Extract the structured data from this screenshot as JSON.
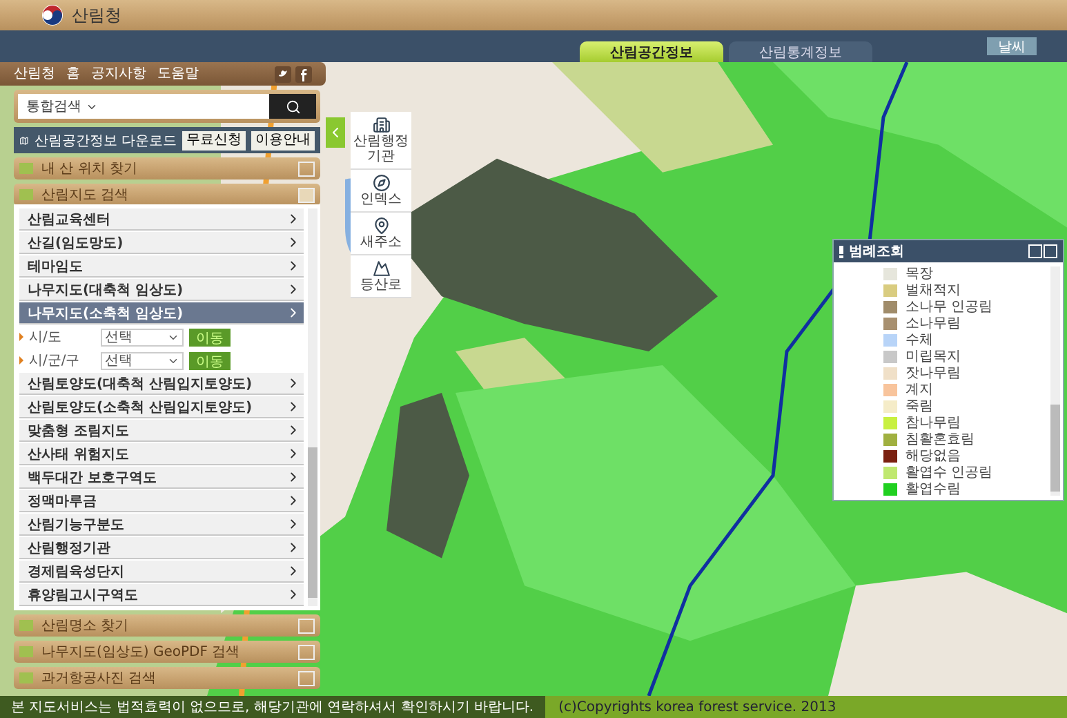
{
  "header": {
    "logo": "산림청"
  },
  "tabs": [
    {
      "label": "산림공간정보",
      "selected": true
    },
    {
      "label": "산림통계정보",
      "selected": false
    }
  ],
  "weather_button": "날씨",
  "nav": {
    "links": [
      "산림청",
      "홈",
      "공지사항",
      "도움말"
    ]
  },
  "search": {
    "scope": "통합검색"
  },
  "download": {
    "label": "산림공간정보 다운로드",
    "buttons": [
      "무료신청",
      "이용안내"
    ]
  },
  "sections": [
    {
      "label": "내 산 위치 찾기",
      "expanded": false
    },
    {
      "label": "산림지도 검색",
      "expanded": true,
      "items": [
        {
          "kind": "link",
          "label": "산림교육센터",
          "selected": false
        },
        {
          "kind": "link",
          "label": "산길(임도망도)",
          "selected": false
        },
        {
          "kind": "link",
          "label": "테마임도",
          "selected": false
        },
        {
          "kind": "link",
          "label": "나무지도(대축척 임상도)",
          "selected": false
        },
        {
          "kind": "link",
          "label": "나무지도(소축척 임상도)",
          "selected": true
        },
        {
          "kind": "select",
          "label": "시/도",
          "value": "선택",
          "button": "이동"
        },
        {
          "kind": "select",
          "label": "시/군/구",
          "value": "선택",
          "button": "이동"
        },
        {
          "kind": "link",
          "label": "산림토양도(대축척 산림입지토양도)",
          "selected": false
        },
        {
          "kind": "link",
          "label": "산림토양도(소축척 산림입지토양도)",
          "selected": false
        },
        {
          "kind": "link",
          "label": "맞춤형 조림지도",
          "selected": false
        },
        {
          "kind": "link",
          "label": "산사태 위험지도",
          "selected": false
        },
        {
          "kind": "link",
          "label": "백두대간 보호구역도",
          "selected": false
        },
        {
          "kind": "link",
          "label": "정맥마루금",
          "selected": false
        },
        {
          "kind": "link",
          "label": "산림기능구분도",
          "selected": false
        },
        {
          "kind": "link",
          "label": "산림행정기관",
          "selected": false
        },
        {
          "kind": "link",
          "label": "경제림육성단지",
          "selected": false
        },
        {
          "kind": "link",
          "label": "휴양림고시구역도",
          "selected": false
        }
      ]
    },
    {
      "label": "산림명소 찾기",
      "expanded": false
    },
    {
      "label": "나무지도(임상도) GeoPDF 검색",
      "expanded": false
    },
    {
      "label": "과거항공사진 검색",
      "expanded": false
    }
  ],
  "tools": [
    "산림행정기관",
    "인덱스",
    "새주소",
    "등산로"
  ],
  "legend": {
    "title": "범례조회",
    "items": [
      {
        "label": "목장",
        "color": "#e6e6dc"
      },
      {
        "label": "벌채적지",
        "color": "#d9cc80"
      },
      {
        "label": "소나무 인공림",
        "color": "#a08c6a"
      },
      {
        "label": "소나무림",
        "color": "#a89070"
      },
      {
        "label": "수체",
        "color": "#b8d4f8"
      },
      {
        "label": "미립목지",
        "color": "#c8c8c8"
      },
      {
        "label": "잣나무림",
        "color": "#f0e0c8"
      },
      {
        "label": "계지",
        "color": "#f8c49c"
      },
      {
        "label": "죽림",
        "color": "#f5ecc8"
      },
      {
        "label": "참나무림",
        "color": "#c8f040"
      },
      {
        "label": "침활혼효림",
        "color": "#a0b040"
      },
      {
        "label": "해당없음",
        "color": "#7a2010"
      },
      {
        "label": "활엽수 인공림",
        "color": "#c0e870"
      },
      {
        "label": "활엽수림",
        "color": "#20d020"
      }
    ]
  },
  "footer": {
    "notice": "본 지도서비스는 법적효력이 없으므로, 해당기관에 연락하셔서 확인하시기 바랍니다.",
    "copyright": "(c)Copyrights korea forest service. 2013"
  }
}
